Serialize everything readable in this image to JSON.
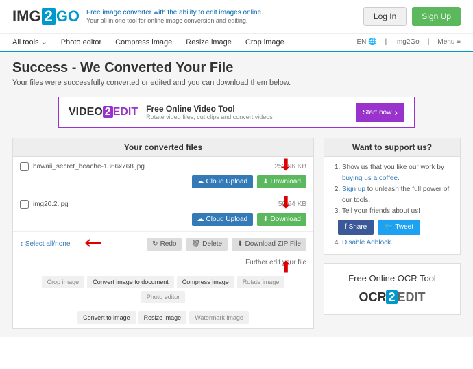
{
  "header": {
    "logo_img": "IMG",
    "logo_two": "2",
    "logo_go": "GO",
    "tagline_main": "Free image converter with the ability to edit images online.",
    "tagline_sub": "Your all in one tool for online image conversion and editing.",
    "login": "Log In",
    "signup": "Sign Up"
  },
  "nav": {
    "items": [
      "All tools ⌄",
      "Photo editor",
      "Compress image",
      "Resize image",
      "Crop image"
    ],
    "lang": "EN 🌐",
    "brand": "Img2Go",
    "menu": "Menu ≡"
  },
  "page": {
    "title": "Success - We Converted Your File",
    "subtitle": "Your files were successfully converted or edited and you can download them below."
  },
  "banner": {
    "logo_video": "VIDEO",
    "logo_two": "2",
    "logo_edit": "EDIT",
    "title": "Free Online Video Tool",
    "sub": "Rotate video files, cut clips and convert videos",
    "btn": "Start now"
  },
  "files": {
    "header": "Your converted files",
    "rows": [
      {
        "name": "hawaii_secret_beache-1366x768.jpg",
        "size": "252.96 KB"
      },
      {
        "name": "img20.2.jpg",
        "size": "59.64 KB"
      }
    ],
    "cloud": "Cloud Upload",
    "download": "Download",
    "select_all": "Select all/none",
    "redo": "Redo",
    "delete": "Delete",
    "zip": "Download ZIP File",
    "further": "Further edit your file",
    "tools": [
      "Crop image",
      "Convert image to document",
      "Compress image",
      "Rotate image",
      "Photo editor",
      "Convert to image",
      "Resize image",
      "Watermark image"
    ]
  },
  "support": {
    "header": "Want to support us?",
    "items": [
      {
        "pre": "Show us that you like our work by ",
        "link": "buying us a coffee",
        "post": "."
      },
      {
        "pre": "",
        "link": "Sign up",
        "post": " to unleash the full power of our tools."
      },
      {
        "pre": "Tell your friends about us!",
        "link": "",
        "post": ""
      },
      {
        "pre": "",
        "link": "Disable Adblock.",
        "post": ""
      }
    ],
    "share": "Share",
    "tweet": "Tweet"
  },
  "ocr": {
    "title": "Free Online OCR Tool",
    "logo_ocr": "OCR",
    "logo_two": "2",
    "logo_edit": "EDIT"
  }
}
